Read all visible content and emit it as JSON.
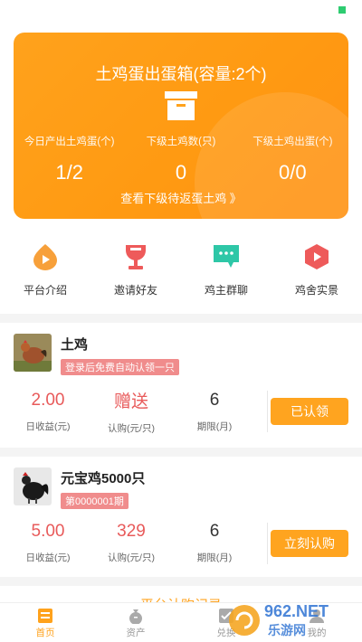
{
  "hero": {
    "title": "土鸡蛋出蛋箱(容量:2个)",
    "stats": [
      {
        "label": "今日产出土鸡蛋(个)",
        "value": "1/2"
      },
      {
        "label": "下级土鸡数(只)",
        "value": "0"
      },
      {
        "label": "下级土鸡出蛋(个)",
        "value": "0/0"
      }
    ],
    "link": "查看下级待返蛋土鸡 》"
  },
  "quick_nav": [
    {
      "label": "平台介绍",
      "icon": "platform-intro-icon",
      "color": "#f7a03a"
    },
    {
      "label": "邀请好友",
      "icon": "invite-friend-icon",
      "color": "#ee5a5a"
    },
    {
      "label": "鸡主群聊",
      "icon": "group-chat-icon",
      "color": "#2ec7a7"
    },
    {
      "label": "鸡舍实景",
      "icon": "coop-live-icon",
      "color": "#ee5a5a"
    }
  ],
  "products": [
    {
      "name": "土鸡",
      "tag": "登录后免费自动认领一只",
      "stats": [
        {
          "value": "2.00",
          "label": "日收益(元)"
        },
        {
          "value": "赠送",
          "label": "认购(元/只)"
        },
        {
          "value": "6",
          "label": "期限(月)"
        }
      ],
      "button": "已认领"
    },
    {
      "name": "元宝鸡5000只",
      "tag": "第0000001期",
      "stats": [
        {
          "value": "5.00",
          "label": "日收益(元)"
        },
        {
          "value": "329",
          "label": "认购(元/只)"
        },
        {
          "value": "6",
          "label": "期限(月)"
        }
      ],
      "button": "立刻认购"
    }
  ],
  "records": {
    "title": "平台认购记录"
  },
  "tabbar": [
    {
      "label": "首页",
      "active": true
    },
    {
      "label": "资产",
      "active": false
    },
    {
      "label": "兑换",
      "active": false
    },
    {
      "label": "我的",
      "active": false
    }
  ],
  "watermark": {
    "brand": "962.NET",
    "site": "乐游网"
  },
  "colors": {
    "accent": "#ffa21c",
    "price": "#e85a5a",
    "tag": "#f08c8c"
  }
}
